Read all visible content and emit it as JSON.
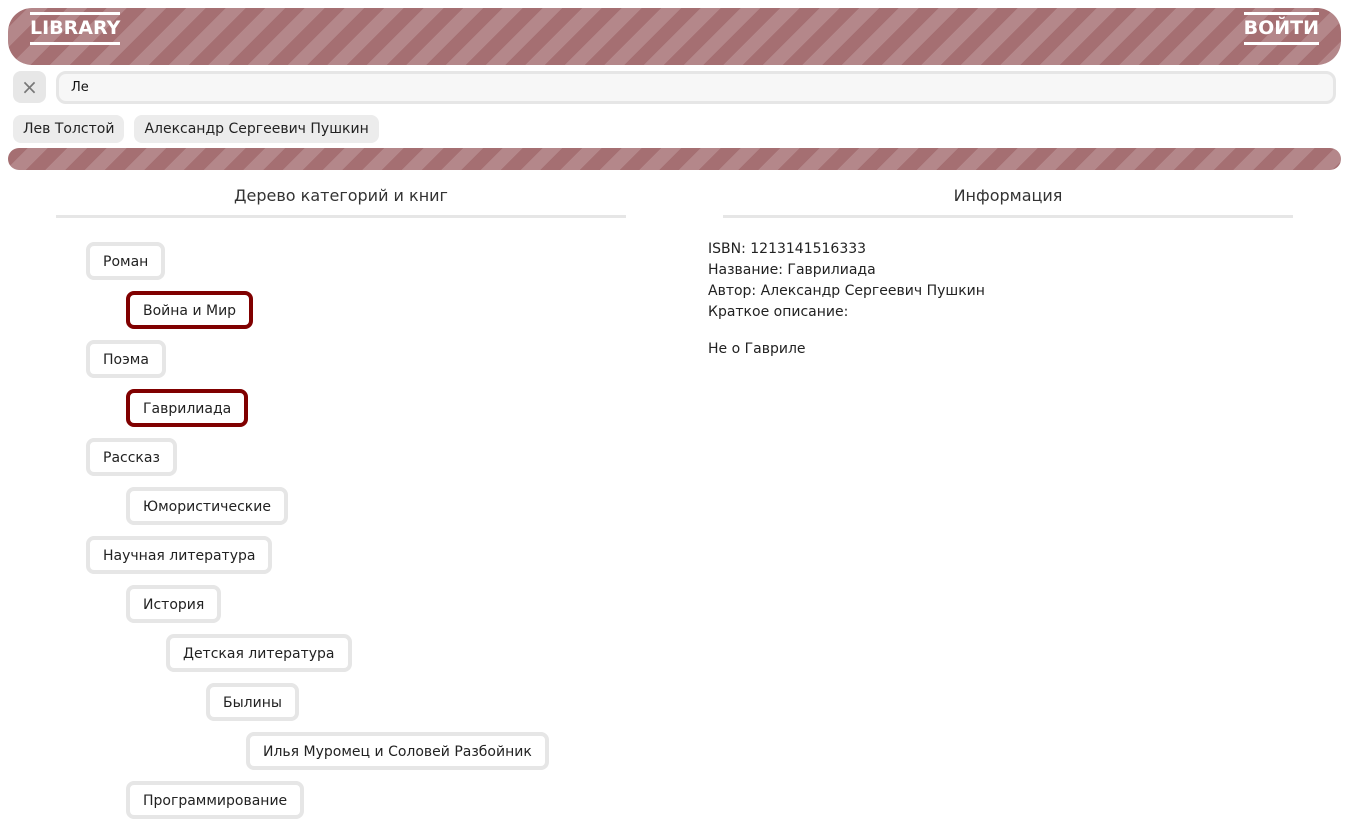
{
  "header": {
    "brand": "LIBRARY",
    "login": "ВОЙТИ"
  },
  "search": {
    "clear_icon": "×",
    "value": "Ле"
  },
  "suggestions": [
    "Лев Толстой",
    "Александр Сергеевич Пушкин"
  ],
  "tree_panel": {
    "title": "Дерево категорий и книг",
    "nodes": [
      {
        "label": "Роман",
        "level": 0,
        "selected": false
      },
      {
        "label": "Война и Мир",
        "level": 1,
        "selected": true
      },
      {
        "label": "Поэма",
        "level": 0,
        "selected": false
      },
      {
        "label": "Гаврилиада",
        "level": 1,
        "selected": true
      },
      {
        "label": "Рассказ",
        "level": 0,
        "selected": false
      },
      {
        "label": "Юмористические",
        "level": 1,
        "selected": false
      },
      {
        "label": "Научная литература",
        "level": 0,
        "selected": false
      },
      {
        "label": "История",
        "level": 1,
        "selected": false
      },
      {
        "label": "Детская литература",
        "level": 2,
        "selected": false
      },
      {
        "label": "Былины",
        "level": 3,
        "selected": false
      },
      {
        "label": "Илья Муромец и Соловей Разбойник",
        "level": 4,
        "selected": false
      },
      {
        "label": "Программирование",
        "level": 1,
        "selected": false
      }
    ]
  },
  "info_panel": {
    "title": "Информация",
    "isbn": "ISBN: 1213141516333",
    "name": "Название: Гаврилиада",
    "author": "Автор: Александр Сергеевич Пушкин",
    "summary_label": "Краткое описание:",
    "summary": "Не о Гавриле"
  },
  "colors": {
    "accent": "#800000",
    "stripe_dark": "#a56f72",
    "stripe_light": "#b4878a",
    "border": "#e6e6e6"
  }
}
